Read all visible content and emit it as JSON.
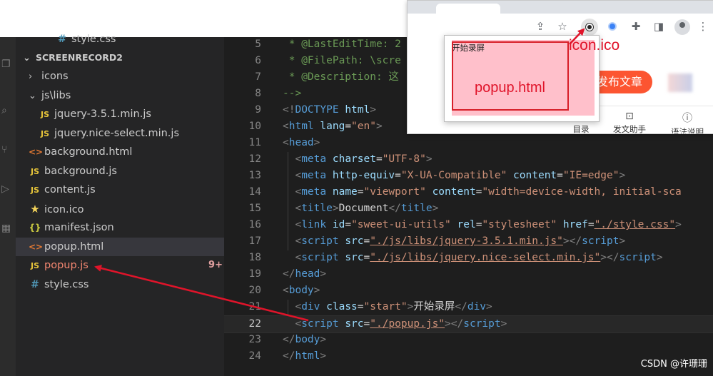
{
  "explorer": {
    "partial_top_item": "style.css",
    "section_title": "SCREENRECORD2",
    "items": [
      {
        "label": "icons",
        "icon": "chevron-right-icon"
      },
      {
        "label": "js\\libs",
        "icon": "chevron-down-icon"
      },
      {
        "label": "jquery-3.5.1.min.js",
        "icon": "js-file-icon"
      },
      {
        "label": "jquery.nice-select.min.js",
        "icon": "js-file-icon"
      },
      {
        "label": "background.html",
        "icon": "html-file-icon"
      },
      {
        "label": "background.js",
        "icon": "js-file-icon"
      },
      {
        "label": "content.js",
        "icon": "js-file-icon"
      },
      {
        "label": "icon.ico",
        "icon": "star-file-icon"
      },
      {
        "label": "manifest.json",
        "icon": "json-file-icon"
      },
      {
        "label": "popup.html",
        "icon": "html-file-icon"
      },
      {
        "label": "popup.js",
        "icon": "js-file-icon",
        "badge": "9+"
      },
      {
        "label": "style.css",
        "icon": "css-file-icon"
      }
    ]
  },
  "editor": {
    "current_line": 22,
    "lines": [
      {
        "n": "5",
        "segs": [
          [
            "c-cmt",
            " * @LastEditTime: 2"
          ]
        ]
      },
      {
        "n": "6",
        "segs": [
          [
            "c-cmt",
            " * @FilePath: \\scre"
          ]
        ]
      },
      {
        "n": "7",
        "segs": [
          [
            "c-cmt",
            " * @Description: 这"
          ]
        ]
      },
      {
        "n": "8",
        "segs": [
          [
            "c-cmt",
            "-->"
          ]
        ]
      },
      {
        "n": "9",
        "segs": [
          [
            "c-punct",
            "<!"
          ],
          [
            "c-tag",
            "DOCTYPE"
          ],
          [
            "c-txt",
            " "
          ],
          [
            "c-attr",
            "html"
          ],
          [
            "c-punct",
            ">"
          ]
        ]
      },
      {
        "n": "10",
        "segs": [
          [
            "c-punct",
            "<"
          ],
          [
            "c-tag",
            "html"
          ],
          [
            "c-txt",
            " "
          ],
          [
            "c-attr",
            "lang"
          ],
          [
            "c-txt",
            "="
          ],
          [
            "c-str",
            "\"en\""
          ],
          [
            "c-punct",
            ">"
          ]
        ]
      },
      {
        "n": "11",
        "segs": [
          [
            "c-punct",
            "<"
          ],
          [
            "c-tag",
            "head"
          ],
          [
            "c-punct",
            ">"
          ]
        ]
      },
      {
        "n": "12",
        "segs": [
          [
            "c-txt",
            "  "
          ],
          [
            "c-punct",
            "<"
          ],
          [
            "c-tag",
            "meta"
          ],
          [
            "c-txt",
            " "
          ],
          [
            "c-attr",
            "charset"
          ],
          [
            "c-txt",
            "="
          ],
          [
            "c-str",
            "\"UTF-8\""
          ],
          [
            "c-punct",
            ">"
          ]
        ]
      },
      {
        "n": "13",
        "segs": [
          [
            "c-txt",
            "  "
          ],
          [
            "c-punct",
            "<"
          ],
          [
            "c-tag",
            "meta"
          ],
          [
            "c-txt",
            " "
          ],
          [
            "c-attr",
            "http-equiv"
          ],
          [
            "c-txt",
            "="
          ],
          [
            "c-str",
            "\"X-UA-Compatible\""
          ],
          [
            "c-txt",
            " "
          ],
          [
            "c-attr",
            "content"
          ],
          [
            "c-txt",
            "="
          ],
          [
            "c-str",
            "\"IE=edge\""
          ],
          [
            "c-punct",
            ">"
          ]
        ]
      },
      {
        "n": "14",
        "segs": [
          [
            "c-txt",
            "  "
          ],
          [
            "c-punct",
            "<"
          ],
          [
            "c-tag",
            "meta"
          ],
          [
            "c-txt",
            " "
          ],
          [
            "c-attr",
            "name"
          ],
          [
            "c-txt",
            "="
          ],
          [
            "c-str",
            "\"viewport\""
          ],
          [
            "c-txt",
            " "
          ],
          [
            "c-attr",
            "content"
          ],
          [
            "c-txt",
            "="
          ],
          [
            "c-str",
            "\"width=device-width, initial-sca"
          ]
        ]
      },
      {
        "n": "15",
        "segs": [
          [
            "c-txt",
            "  "
          ],
          [
            "c-punct",
            "<"
          ],
          [
            "c-tag",
            "title"
          ],
          [
            "c-punct",
            ">"
          ],
          [
            "c-txt",
            "Document"
          ],
          [
            "c-punct",
            "</"
          ],
          [
            "c-tag",
            "title"
          ],
          [
            "c-punct",
            ">"
          ]
        ]
      },
      {
        "n": "16",
        "segs": [
          [
            "c-txt",
            "  "
          ],
          [
            "c-punct",
            "<"
          ],
          [
            "c-tag",
            "link"
          ],
          [
            "c-txt",
            " "
          ],
          [
            "c-attr",
            "id"
          ],
          [
            "c-txt",
            "="
          ],
          [
            "c-str",
            "\"sweet-ui-utils\""
          ],
          [
            "c-txt",
            " "
          ],
          [
            "c-attr",
            "rel"
          ],
          [
            "c-txt",
            "="
          ],
          [
            "c-str",
            "\"stylesheet\""
          ],
          [
            "c-txt",
            " "
          ],
          [
            "c-attr",
            "href"
          ],
          [
            "c-txt",
            "="
          ],
          [
            "c-str link",
            "\"./style.css\""
          ],
          [
            "c-punct",
            ">"
          ]
        ]
      },
      {
        "n": "17",
        "segs": [
          [
            "c-txt",
            "  "
          ],
          [
            "c-punct",
            "<"
          ],
          [
            "c-tag",
            "script"
          ],
          [
            "c-txt",
            " "
          ],
          [
            "c-attr",
            "src"
          ],
          [
            "c-txt",
            "="
          ],
          [
            "c-str link",
            "\"./js/libs/jquery-3.5.1.min.js\""
          ],
          [
            "c-punct",
            "></"
          ],
          [
            "c-tag",
            "script"
          ],
          [
            "c-punct",
            ">"
          ]
        ]
      },
      {
        "n": "18",
        "segs": [
          [
            "c-txt",
            "  "
          ],
          [
            "c-punct",
            "<"
          ],
          [
            "c-tag",
            "script"
          ],
          [
            "c-txt",
            " "
          ],
          [
            "c-attr",
            "src"
          ],
          [
            "c-txt",
            "="
          ],
          [
            "c-str link",
            "\"./js/libs/jquery.nice-select.min.js\""
          ],
          [
            "c-punct",
            "></"
          ],
          [
            "c-tag",
            "script"
          ],
          [
            "c-punct",
            ">"
          ]
        ]
      },
      {
        "n": "19",
        "segs": [
          [
            "c-punct",
            "</"
          ],
          [
            "c-tag",
            "head"
          ],
          [
            "c-punct",
            ">"
          ]
        ]
      },
      {
        "n": "20",
        "segs": [
          [
            "c-punct",
            "<"
          ],
          [
            "c-tag",
            "body"
          ],
          [
            "c-punct",
            ">"
          ]
        ]
      },
      {
        "n": "21",
        "segs": [
          [
            "c-txt",
            "  "
          ],
          [
            "c-punct",
            "<"
          ],
          [
            "c-tag",
            "div"
          ],
          [
            "c-txt",
            " "
          ],
          [
            "c-attr",
            "class"
          ],
          [
            "c-txt",
            "="
          ],
          [
            "c-str",
            "\"start\""
          ],
          [
            "c-punct",
            ">"
          ],
          [
            "c-txt",
            "开始录屏"
          ],
          [
            "c-punct",
            "</"
          ],
          [
            "c-tag",
            "div"
          ],
          [
            "c-punct",
            ">"
          ]
        ]
      },
      {
        "n": "22",
        "segs": [
          [
            "c-txt",
            "  "
          ],
          [
            "c-punct",
            "<"
          ],
          [
            "c-tag",
            "script"
          ],
          [
            "c-txt",
            " "
          ],
          [
            "c-attr",
            "src"
          ],
          [
            "c-txt",
            "="
          ],
          [
            "c-str link",
            "\"./popup.js\""
          ],
          [
            "c-punct",
            "></"
          ],
          [
            "c-tag",
            "script"
          ],
          [
            "c-punct",
            ">"
          ]
        ]
      },
      {
        "n": "23",
        "segs": [
          [
            "c-punct",
            "</"
          ],
          [
            "c-tag",
            "body"
          ],
          [
            "c-punct",
            ">"
          ]
        ]
      },
      {
        "n": "24",
        "segs": [
          [
            "c-punct",
            "</"
          ],
          [
            "c-tag",
            "html"
          ],
          [
            "c-punct",
            ">"
          ]
        ]
      }
    ]
  },
  "browser": {
    "publish_button": "发布文章",
    "page_buttons": [
      {
        "label": "目录",
        "icon": "list-icon"
      },
      {
        "label": "发文助手",
        "icon": "chat-icon"
      },
      {
        "label": "语法说明",
        "icon": "help-icon"
      }
    ],
    "toolbar_icons": [
      "share-icon",
      "star-icon",
      "record-extension-icon",
      "blue-extension-icon",
      "puzzle-icon",
      "sidebar-icon",
      "profile-icon",
      "more-icon"
    ]
  },
  "popup": {
    "start_text": "开始录屏",
    "annotation": "popup.html"
  },
  "annotations": {
    "icon_label": "icon.ico",
    "arrow_color": "#e0142a"
  },
  "watermark": "CSDN @许珊珊"
}
